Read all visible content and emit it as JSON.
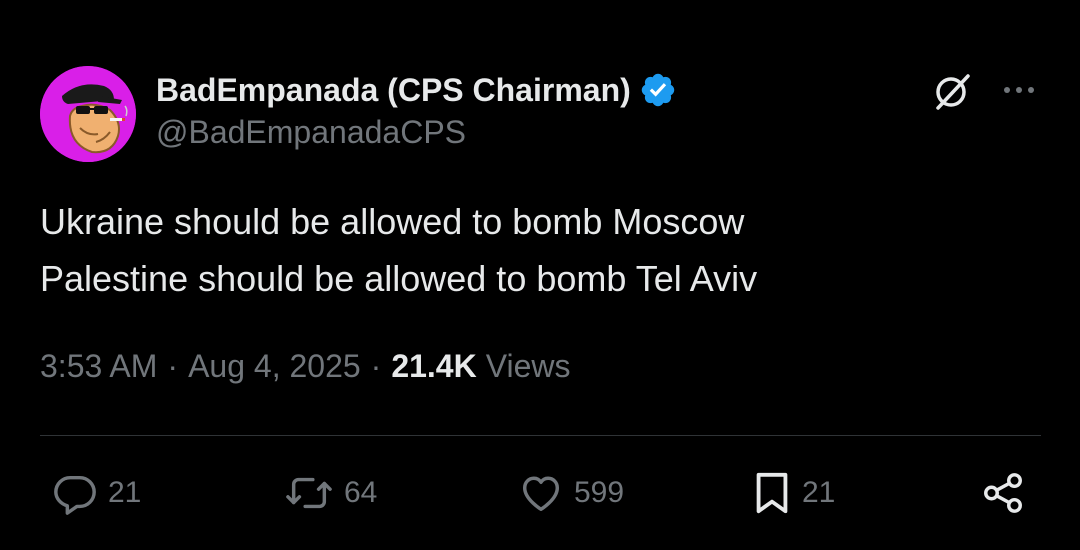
{
  "author": {
    "display_name": "BadEmpanada (CPS Chairman)",
    "handle": "@BadEmpanadaCPS",
    "verified": true,
    "avatar_bg": "#d91fe8"
  },
  "tweet": {
    "lines": [
      "Ukraine should be allowed to bomb Moscow",
      "Palestine should be allowed to bomb Tel Aviv"
    ],
    "time": "3:53 AM",
    "separator": "·",
    "date": "Aug 4, 2025",
    "views_count": "21.4K",
    "views_label": "Views"
  },
  "actions": {
    "replies": "21",
    "reposts": "64",
    "likes": "599",
    "bookmarks": "21"
  },
  "icons": {
    "grok": "grok-icon",
    "more": "more-icon",
    "reply": "reply-icon",
    "repost": "repost-icon",
    "like": "heart-icon",
    "bookmark": "bookmark-icon",
    "share": "share-icon",
    "verified": "verified-badge-icon"
  },
  "colors": {
    "background": "#000000",
    "text_primary": "#e7e9ea",
    "text_secondary": "#71767b",
    "verified_blue": "#1d9bf0",
    "divider": "#2f3336"
  }
}
